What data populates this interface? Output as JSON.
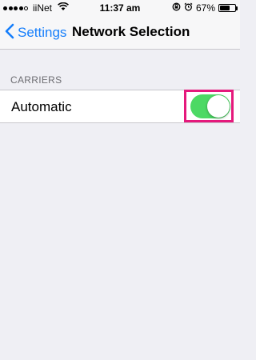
{
  "status_bar": {
    "carrier": "iiNet",
    "time": "11:37 am",
    "battery_percent": "67%",
    "battery_level": 0.67,
    "signal_bars_filled": 4,
    "signal_bars_total": 5
  },
  "nav": {
    "back_label": "Settings",
    "title": "Network Selection"
  },
  "carriers_section": {
    "header": "CARRIERS",
    "automatic_label": "Automatic",
    "automatic_on": true
  },
  "colors": {
    "accent": "#157efb",
    "toggle_on": "#4cd964",
    "highlight": "#e5197c",
    "background": "#efeff4"
  },
  "icons": {
    "back": "chevron-left-icon",
    "wifi": "wifi-icon",
    "rotation_lock": "rotation-lock-icon",
    "alarm": "alarm-icon",
    "battery": "battery-icon"
  }
}
